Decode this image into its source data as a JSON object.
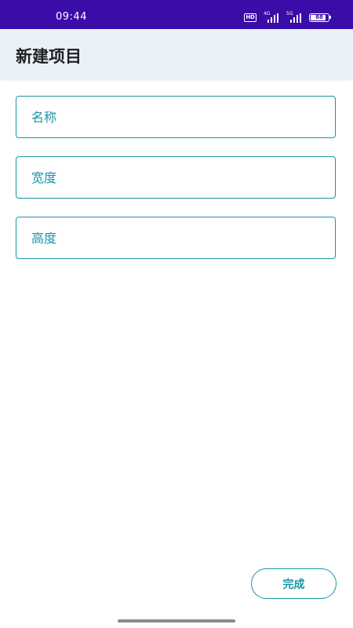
{
  "status_bar": {
    "time": "09:44",
    "hd_label": "HD",
    "signal_1_label": "4G",
    "signal_2_label": "5G",
    "battery_level": "88"
  },
  "app_bar": {
    "title": "新建项目"
  },
  "form": {
    "name_placeholder": "名称",
    "width_placeholder": "宽度",
    "height_placeholder": "高度"
  },
  "actions": {
    "done_label": "完成"
  },
  "colors": {
    "status_bar": "#3a0ca8",
    "app_bar": "#eaf1f8",
    "accent": "#1a95a8"
  }
}
